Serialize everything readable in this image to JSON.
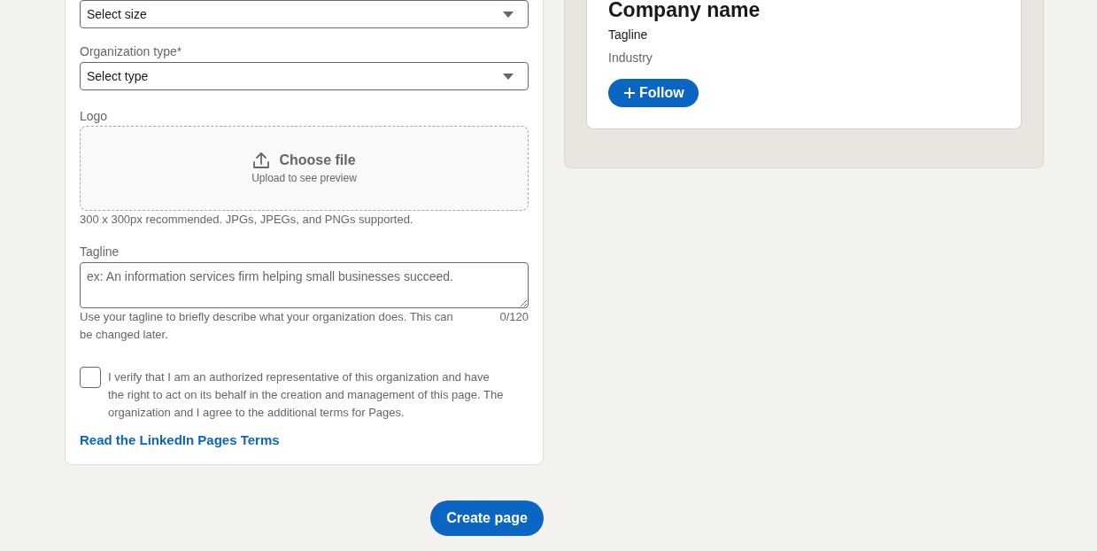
{
  "form": {
    "fields": [
      {
        "kind": "select",
        "value": "Select size"
      },
      {
        "kind": "select",
        "label": "Organization type*",
        "value": "Select type"
      },
      {
        "kind": "upload",
        "label": "Logo",
        "button": "Choose file",
        "subtext": "Upload to see preview",
        "hint": "300 x 300px recommended. JPGs, JPEGs, and PNGs supported."
      },
      {
        "kind": "textarea",
        "label": "Tagline",
        "placeholder": "ex: An information services firm helping small businesses succeed.",
        "hint": "Use your tagline to briefly describe what your organization does. This can be changed later.",
        "counter": "0/120"
      }
    ],
    "verification": {
      "checked": false,
      "text": "I verify that I am an authorized representative of this organization and have the right to act on its behalf in the creation and management of this page. The organization and I agree to the additional terms for Pages."
    },
    "terms_link": "Read the LinkedIn Pages Terms"
  },
  "create_button": "Create page",
  "preview": {
    "company_name": "Company name",
    "tagline": "Tagline",
    "industry": "Industry",
    "follow_button": "Follow"
  }
}
